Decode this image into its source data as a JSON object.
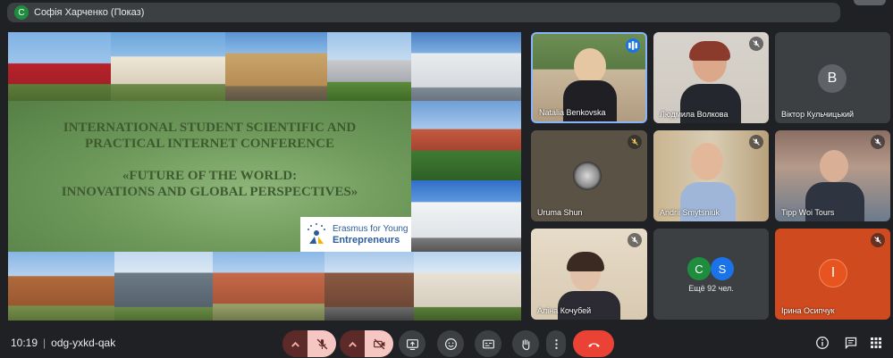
{
  "presenter": {
    "avatar_letter": "C",
    "label": "Софія Харченко (Показ)"
  },
  "slide": {
    "title_line1": "INTERNATIONAL STUDENT SCIENTIFIC AND",
    "title_line2": "PRACTICAL INTERNET CONFERENCE",
    "subtitle_line1": "«FUTURE OF THE WORLD:",
    "subtitle_line2": "INNOVATIONS AND GLOBAL PERSPECTIVES»",
    "logo_line1": "Erasmus for Young",
    "logo_line2": "Entrepreneurs"
  },
  "participants": [
    {
      "name": "Natalia Benkovska",
      "muted": false,
      "speaking": true
    },
    {
      "name": "Людмила Волкова",
      "muted": true
    },
    {
      "name": "Віктор Кульчицький",
      "muted": false,
      "avatar_letter": "B"
    },
    {
      "name": "Uruma Shun",
      "muted": true
    },
    {
      "name": "Andrii Smytsniuk",
      "muted": true
    },
    {
      "name": "Tipp Woi Tours",
      "muted": true
    },
    {
      "name": "Аліна Кочубей",
      "muted": true
    },
    {
      "more_label": "Ещё 92 чел.",
      "avatars": [
        "C",
        "S"
      ]
    },
    {
      "name": "Ірина Осипчук",
      "muted": true,
      "avatar_letter": "I"
    }
  ],
  "bottombar": {
    "time": "10:19",
    "meeting_code": "odg-yxkd-qak"
  },
  "colors": {
    "background": "#202124",
    "tile": "#3c4043",
    "end_call": "#ea4335",
    "mic_off_bg": "#f6c6c2",
    "speaking": "#1a73e8"
  }
}
